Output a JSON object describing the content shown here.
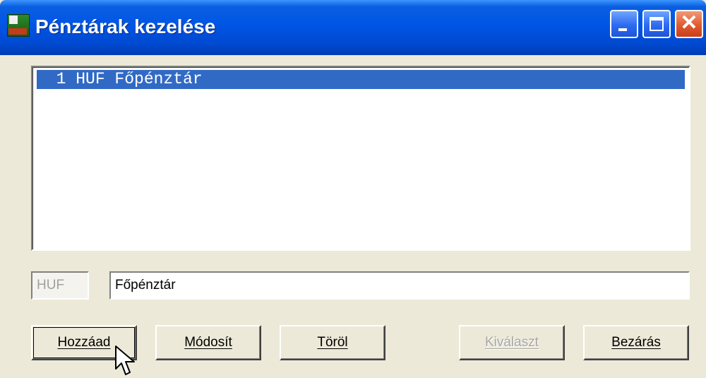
{
  "window": {
    "title": "Pénztárak kezelése",
    "icon": "app-icon",
    "controls": [
      "minimize-icon",
      "maximize-icon",
      "close-icon"
    ]
  },
  "list": {
    "items": [
      {
        "text": "  1 HUF Főpénztár",
        "selected": true
      }
    ]
  },
  "fields": {
    "currency": "HUF",
    "name": "Főpénztár"
  },
  "buttons": {
    "add": "Hozzáad",
    "modify": "Módosít",
    "delete": "Töröl",
    "select": "Kiválaszt",
    "close": "Bezárás"
  },
  "colors": {
    "titlebar": "#0055e5",
    "selection": "#316ac5",
    "disabled_text": "#a7a7a7"
  }
}
